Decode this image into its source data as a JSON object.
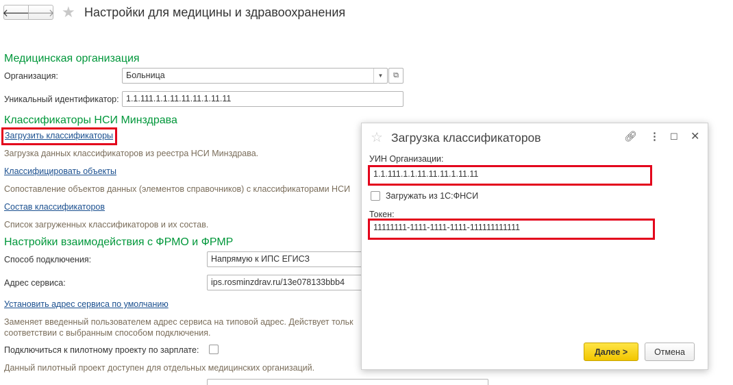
{
  "nav": {
    "back": "🡐",
    "forward": "🡒"
  },
  "window": {
    "title": "Настройки для медицины и здравоохранения"
  },
  "med_org": {
    "section_title": "Медицинская организация",
    "org_label": "Организация:",
    "org_value": "Больница",
    "uid_label": "Уникальный идентификатор:",
    "uid_value": "1.1.111.1.1.11.11.11.1.11.11"
  },
  "classifiers": {
    "section_title": "Классификаторы НСИ Минздрава",
    "load_link": "Загрузить классификаторы",
    "load_note": "Загрузка данных классификаторов из реестра НСИ Минздрава.",
    "classify_link": "Классифицировать объекты",
    "classify_note": "Сопоставление объектов данных (элементов справочников) с классификаторами НСИ",
    "composition_link": "Состав классификаторов",
    "composition_note": "Список загруженных классификаторов и их состав."
  },
  "frmo": {
    "section_title": "Настройки взаимодействия с ФРМО и ФРМР",
    "connection_label": "Способ подключения:",
    "connection_value": "Напрямую к ИПС ЕГИСЗ",
    "address_label": "Адрес сервиса:",
    "address_value": "ips.rosminzdrav.ru/13e078133bbb4",
    "default_link": "Установить адрес сервиса по умолчанию",
    "default_note_1": "Заменяет введенный пользователем адрес сервиса на типовой адрес. Действует тольк",
    "default_note_2": "соответствии с выбранным способом подключения.",
    "pilot_label": "Подключиться к пилотному проекту по зарплате:",
    "pilot_note": "Данный пилотный проект доступен для отдельных медицинских организаций."
  },
  "dialog": {
    "title": "Загрузка классификаторов",
    "uin_label": "УИН Организации:",
    "uin_value": "1.1.111.1.1.11.11.11.1.11.11",
    "fnsi_label": "Загружать из 1С:ФНСИ",
    "token_label": "Токен:",
    "token_value": "11111111-1111-1111-1111-111111111111",
    "next_button": "Далее >",
    "cancel_button": "Отмена"
  },
  "colors": {
    "section_green": "#00973a",
    "link_blue": "#1a4f8f",
    "note_brown": "#7a6d5a",
    "highlight_red": "#e3001b",
    "primary_yellow": "#f2c600"
  }
}
